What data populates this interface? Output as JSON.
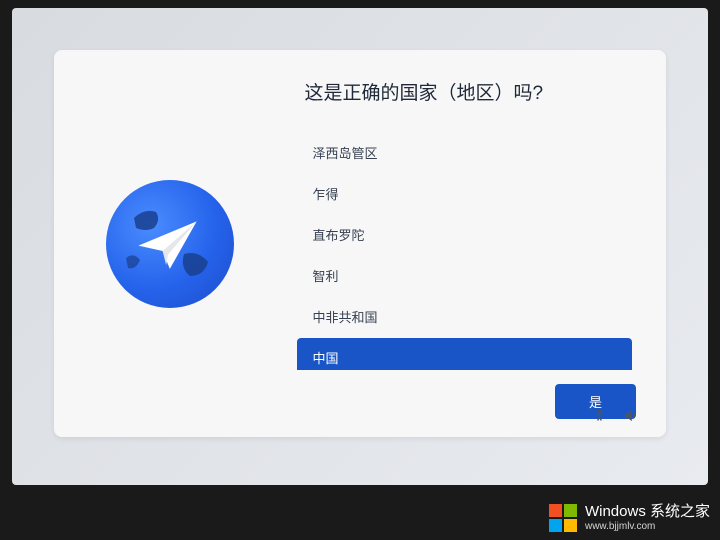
{
  "title": "这是正确的国家（地区）吗?",
  "regions": [
    {
      "label": "泽西岛管区",
      "selected": false
    },
    {
      "label": "乍得",
      "selected": false
    },
    {
      "label": "直布罗陀",
      "selected": false
    },
    {
      "label": "智利",
      "selected": false
    },
    {
      "label": "中非共和国",
      "selected": false
    },
    {
      "label": "中国",
      "selected": true
    }
  ],
  "confirm_label": "是",
  "watermark": {
    "main": "Windows 系统之家",
    "sub": "www.bjjmlv.com"
  }
}
